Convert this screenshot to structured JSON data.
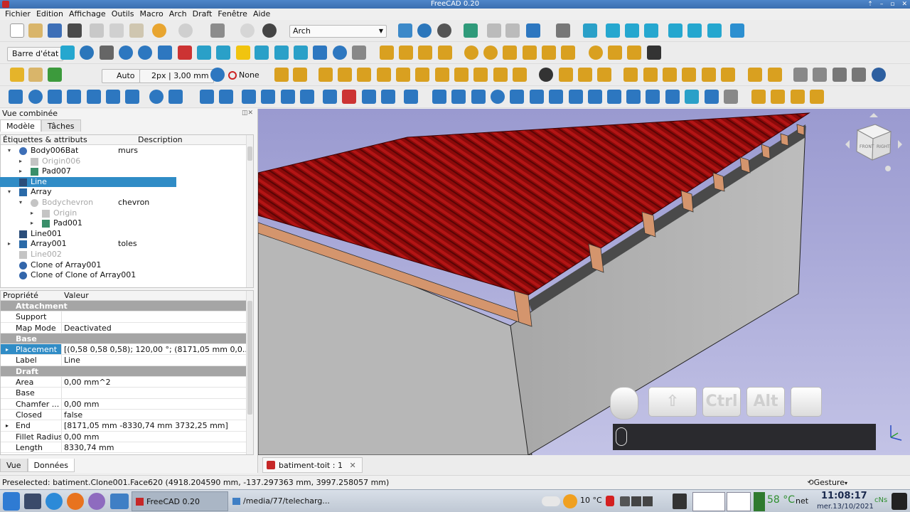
{
  "window": {
    "title": "FreeCAD 0.20",
    "controls": [
      "⇡",
      "–",
      "▫",
      "✕"
    ]
  },
  "menu": [
    "Fichier",
    "Edition",
    "Affichage",
    "Outils",
    "Macro",
    "Arch",
    "Draft",
    "Fenêtre",
    "Aide"
  ],
  "toolbar": {
    "workbench": "Arch",
    "status_bar_button": "Barre d'état",
    "auto_label": "Auto",
    "line_width": "2px | 3,00 mm",
    "none_label": "None"
  },
  "combo_view": {
    "title": "Vue combinée",
    "tabs": [
      "Modèle",
      "Tâches"
    ],
    "tree_headers": [
      "Étiquettes & attributs",
      "Description"
    ],
    "tree": [
      {
        "label": "Body006Bat",
        "desc": "murs",
        "indent": 1,
        "expander": "▾",
        "icon": "body",
        "dim": false,
        "selected": false
      },
      {
        "label": "Origin006",
        "desc": "",
        "indent": 2,
        "expander": "▸",
        "icon": "origin",
        "dim": true,
        "selected": false
      },
      {
        "label": "Pad007",
        "desc": "",
        "indent": 2,
        "expander": "▸",
        "icon": "pad",
        "dim": false,
        "selected": false
      },
      {
        "label": "Line",
        "desc": "",
        "indent": 1,
        "expander": "",
        "icon": "line",
        "dim": false,
        "selected": true
      },
      {
        "label": "Array",
        "desc": "",
        "indent": 1,
        "expander": "▾",
        "icon": "array",
        "dim": false,
        "selected": false
      },
      {
        "label": "Bodychevron",
        "desc": "chevron",
        "indent": 2,
        "expander": "▾",
        "icon": "body",
        "dim": true,
        "selected": false
      },
      {
        "label": "Origin",
        "desc": "",
        "indent": 3,
        "expander": "▸",
        "icon": "origin",
        "dim": true,
        "selected": false
      },
      {
        "label": "Pad001",
        "desc": "",
        "indent": 3,
        "expander": "▸",
        "icon": "pad",
        "dim": false,
        "selected": false
      },
      {
        "label": "Line001",
        "desc": "",
        "indent": 1,
        "expander": "",
        "icon": "line",
        "dim": false,
        "selected": false
      },
      {
        "label": "Array001",
        "desc": "toles",
        "indent": 1,
        "expander": "▸",
        "icon": "array",
        "dim": false,
        "selected": false
      },
      {
        "label": "Line002",
        "desc": "",
        "indent": 1,
        "expander": "",
        "icon": "line",
        "dim": true,
        "selected": false
      },
      {
        "label": "Clone of Array001",
        "desc": "",
        "indent": 1,
        "expander": "",
        "icon": "clone",
        "dim": false,
        "selected": false
      },
      {
        "label": "Clone of Clone of Array001",
        "desc": "",
        "indent": 1,
        "expander": "",
        "icon": "clone",
        "dim": false,
        "selected": false
      }
    ],
    "prop_headers": [
      "Propriété",
      "Valeur"
    ],
    "properties": [
      {
        "group": "Attachment"
      },
      {
        "key": "Support",
        "value": ""
      },
      {
        "key": "Map Mode",
        "value": "Deactivated"
      },
      {
        "group": "Base"
      },
      {
        "key": "Placement",
        "value": "[(0,58 0,58 0,58); 120,00 °; (8171,05 mm  0,0...",
        "highlight": true,
        "expander": "▸"
      },
      {
        "key": "Label",
        "value": "Line"
      },
      {
        "group": "Draft"
      },
      {
        "key": "Area",
        "value": "0,00 mm^2"
      },
      {
        "key": "Base",
        "value": ""
      },
      {
        "key": "Chamfer ...",
        "value": "0,00 mm"
      },
      {
        "key": "Closed",
        "value": "false"
      },
      {
        "key": "End",
        "value": "[8171,05 mm  -8330,74 mm  3732,25 mm]",
        "expander": "▸"
      },
      {
        "key": "Fillet Radius",
        "value": "0,00 mm"
      },
      {
        "key": "Length",
        "value": "8330,74 mm"
      }
    ],
    "bottom_tabs": [
      "Vue",
      "Données"
    ]
  },
  "viewport": {
    "navcube_faces": [
      "FRONT",
      "RIGHT"
    ],
    "keys": [
      "Ctrl",
      "Alt"
    ],
    "colors": {
      "roof": "#8b0a0a",
      "rafter": "#d4956d",
      "wall": "#b3b3b3",
      "sky_top": "#9a9ad0"
    }
  },
  "document_tab": {
    "label": "batiment-toit : 1",
    "close": "✕"
  },
  "nav_style": "Gesture",
  "status": "Preselected: batiment.Clone001.Face620 (4918.204590 mm, -137.297363 mm, 3997.258057 mm)",
  "taskbar": {
    "tasks": [
      "FreeCAD 0.20",
      "/media/77/telecharg..."
    ],
    "weather": "10 °C",
    "temp": "58 °C",
    "net": "net",
    "time": "11:08:17",
    "date": "mer.13/10/2021",
    "lang": "cNs"
  }
}
